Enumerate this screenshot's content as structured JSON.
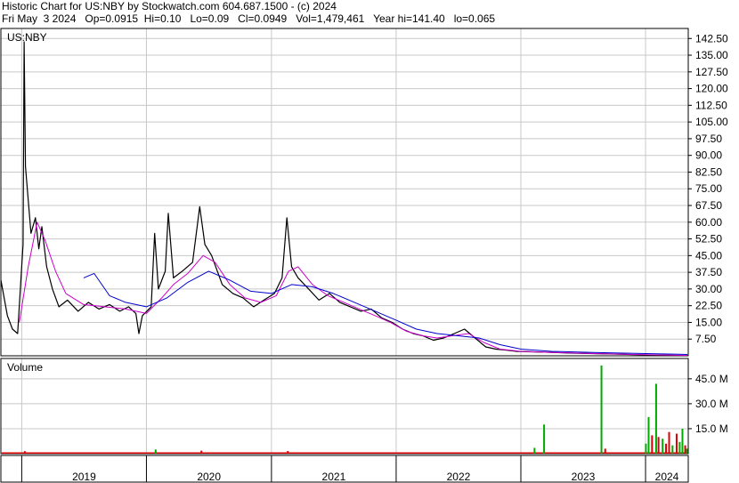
{
  "header": {
    "line1": "Historic Chart for US:NBY by Stockwatch.com 604.687.1500 - (c) 2024",
    "line2": "Fri May  3 2024   Op=0.0915  Hi=0.10   Lo=0.09   Cl=0.0949   Vol=1,479,461   Year hi=141.40   lo=0.065"
  },
  "colors": {
    "price_line": "#000000",
    "ma_short": "#cc00cc",
    "ma_long": "#0000cc",
    "volume_green": "#00aa00",
    "volume_red": "#dd0000",
    "grid": "#c8c8c8"
  },
  "chart_data": [
    {
      "type": "line",
      "title": "US:NBY",
      "ylim": [
        0,
        147
      ],
      "y_ticks": [
        "142.50",
        "135.00",
        "127.50",
        "120.00",
        "112.50",
        "105.00",
        "97.50",
        "90.00",
        "82.50",
        "75.00",
        "67.50",
        "60.00",
        "52.50",
        "45.00",
        "37.50",
        "30.00",
        "22.50",
        "15.00",
        "7.50"
      ],
      "x_labels": [
        "2019",
        "2020",
        "2021",
        "2022",
        "2023",
        "2024"
      ],
      "x_range": [
        "2018-11",
        "2024-05"
      ],
      "series": [
        {
          "style": "price",
          "points": [
            [
              "2018-11-01",
              34
            ],
            [
              "2018-11-20",
              18
            ],
            [
              "2018-12-05",
              12
            ],
            [
              "2018-12-20",
              10
            ],
            [
              "2019-01-05",
              50
            ],
            [
              "2019-01-08",
              141
            ],
            [
              "2019-01-12",
              85
            ],
            [
              "2019-01-20",
              70
            ],
            [
              "2019-01-28",
              55
            ],
            [
              "2019-02-10",
              62
            ],
            [
              "2019-02-20",
              48
            ],
            [
              "2019-03-01",
              58
            ],
            [
              "2019-03-15",
              40
            ],
            [
              "2019-04-01",
              30
            ],
            [
              "2019-04-20",
              22
            ],
            [
              "2019-05-15",
              25
            ],
            [
              "2019-06-15",
              20
            ],
            [
              "2019-07-15",
              24
            ],
            [
              "2019-08-15",
              21
            ],
            [
              "2019-09-15",
              23
            ],
            [
              "2019-10-15",
              20
            ],
            [
              "2019-11-10",
              22
            ],
            [
              "2019-12-01",
              19
            ],
            [
              "2019-12-10",
              10
            ],
            [
              "2019-12-20",
              18
            ],
            [
              "2020-01-15",
              22
            ],
            [
              "2020-01-25",
              55
            ],
            [
              "2020-02-05",
              30
            ],
            [
              "2020-02-25",
              38
            ],
            [
              "2020-03-05",
              64
            ],
            [
              "2020-03-20",
              35
            ],
            [
              "2020-04-15",
              38
            ],
            [
              "2020-05-15",
              42
            ],
            [
              "2020-06-05",
              67
            ],
            [
              "2020-06-20",
              50
            ],
            [
              "2020-07-10",
              45
            ],
            [
              "2020-08-10",
              32
            ],
            [
              "2020-09-10",
              28
            ],
            [
              "2020-10-10",
              26
            ],
            [
              "2020-11-10",
              22
            ],
            [
              "2020-12-10",
              25
            ],
            [
              "2021-01-10",
              28
            ],
            [
              "2021-02-01",
              35
            ],
            [
              "2021-02-15",
              62
            ],
            [
              "2021-03-01",
              40
            ],
            [
              "2021-03-20",
              35
            ],
            [
              "2021-04-20",
              30
            ],
            [
              "2021-05-20",
              25
            ],
            [
              "2021-06-20",
              28
            ],
            [
              "2021-07-20",
              24
            ],
            [
              "2021-08-20",
              22
            ],
            [
              "2021-09-20",
              20
            ],
            [
              "2021-10-20",
              21
            ],
            [
              "2021-11-20",
              17
            ],
            [
              "2021-12-20",
              15
            ],
            [
              "2022-01-20",
              12
            ],
            [
              "2022-02-20",
              10
            ],
            [
              "2022-03-20",
              9
            ],
            [
              "2022-04-20",
              7
            ],
            [
              "2022-05-20",
              8
            ],
            [
              "2022-06-20",
              10
            ],
            [
              "2022-07-20",
              12
            ],
            [
              "2022-08-20",
              8
            ],
            [
              "2022-09-20",
              4
            ],
            [
              "2022-10-20",
              3
            ],
            [
              "2022-11-20",
              2.5
            ],
            [
              "2022-12-20",
              2
            ],
            [
              "2023-02-01",
              1.8
            ],
            [
              "2023-04-01",
              1.5
            ],
            [
              "2023-06-01",
              1.2
            ],
            [
              "2023-08-01",
              1
            ],
            [
              "2023-10-01",
              0.8
            ],
            [
              "2023-12-01",
              0.5
            ],
            [
              "2024-02-01",
              0.3
            ],
            [
              "2024-05-03",
              0.0949
            ]
          ]
        },
        {
          "style": "ma_short",
          "points": [
            [
              "2018-12-25",
              15
            ],
            [
              "2019-01-20",
              40
            ],
            [
              "2019-02-15",
              60
            ],
            [
              "2019-03-10",
              52
            ],
            [
              "2019-04-10",
              38
            ],
            [
              "2019-05-10",
              28
            ],
            [
              "2019-07-01",
              23
            ],
            [
              "2019-09-01",
              22
            ],
            [
              "2019-11-01",
              21
            ],
            [
              "2020-01-01",
              19
            ],
            [
              "2020-02-15",
              26
            ],
            [
              "2020-03-20",
              32
            ],
            [
              "2020-05-01",
              37
            ],
            [
              "2020-06-15",
              45
            ],
            [
              "2020-07-20",
              42
            ],
            [
              "2020-09-01",
              32
            ],
            [
              "2020-10-15",
              26
            ],
            [
              "2020-12-01",
              24
            ],
            [
              "2021-01-15",
              27
            ],
            [
              "2021-02-20",
              38
            ],
            [
              "2021-03-20",
              40
            ],
            [
              "2021-05-01",
              32
            ],
            [
              "2021-06-15",
              27
            ],
            [
              "2021-08-01",
              24
            ],
            [
              "2021-09-15",
              21
            ],
            [
              "2021-11-01",
              18
            ],
            [
              "2021-12-15",
              15
            ],
            [
              "2022-02-01",
              11
            ],
            [
              "2022-03-20",
              9
            ],
            [
              "2022-05-01",
              8
            ],
            [
              "2022-06-15",
              9
            ],
            [
              "2022-08-01",
              10
            ],
            [
              "2022-09-15",
              6
            ],
            [
              "2022-11-01",
              3
            ],
            [
              "2023-01-01",
              2
            ],
            [
              "2023-04-01",
              1.5
            ],
            [
              "2023-08-01",
              1
            ],
            [
              "2024-01-01",
              0.5
            ],
            [
              "2024-05-03",
              0.2
            ]
          ]
        },
        {
          "style": "ma_long",
          "points": [
            [
              "2019-07-01",
              35
            ],
            [
              "2019-08-01",
              37
            ],
            [
              "2019-09-15",
              27
            ],
            [
              "2019-11-01",
              24
            ],
            [
              "2020-01-01",
              22
            ],
            [
              "2020-03-01",
              26
            ],
            [
              "2020-05-01",
              33
            ],
            [
              "2020-07-01",
              38
            ],
            [
              "2020-09-01",
              34
            ],
            [
              "2020-11-01",
              29
            ],
            [
              "2021-01-01",
              28
            ],
            [
              "2021-03-01",
              32
            ],
            [
              "2021-05-01",
              31
            ],
            [
              "2021-07-01",
              28
            ],
            [
              "2021-09-01",
              24
            ],
            [
              "2021-11-01",
              20
            ],
            [
              "2022-01-01",
              16
            ],
            [
              "2022-03-01",
              12
            ],
            [
              "2022-05-01",
              10
            ],
            [
              "2022-07-01",
              9
            ],
            [
              "2022-09-01",
              8
            ],
            [
              "2022-11-01",
              5
            ],
            [
              "2023-01-01",
              3
            ],
            [
              "2023-04-01",
              2
            ],
            [
              "2023-08-01",
              1.5
            ],
            [
              "2024-01-01",
              1
            ],
            [
              "2024-05-03",
              0.6
            ]
          ]
        }
      ]
    },
    {
      "type": "bar",
      "title": "Volume",
      "ylim": [
        0,
        54
      ],
      "y_ticks": [
        "45.0 M",
        "30.0 M",
        "15.0 M"
      ],
      "baseline_volume_m": 0.8,
      "bars": [
        {
          "x": "2019-01-10",
          "v": 1.5,
          "color": "red"
        },
        {
          "x": "2020-01-28",
          "v": 2.5,
          "color": "green"
        },
        {
          "x": "2020-06-10",
          "v": 1.8,
          "color": "red"
        },
        {
          "x": "2021-02-18",
          "v": 1.6,
          "color": "red"
        },
        {
          "x": "2023-02-10",
          "v": 3.5,
          "color": "green"
        },
        {
          "x": "2023-03-10",
          "v": 17.5,
          "color": "green"
        },
        {
          "x": "2023-08-25",
          "v": 53.0,
          "color": "green"
        },
        {
          "x": "2023-09-05",
          "v": 3.0,
          "color": "red"
        },
        {
          "x": "2024-01-02",
          "v": 6.0,
          "color": "green"
        },
        {
          "x": "2024-01-10",
          "v": 22.0,
          "color": "green"
        },
        {
          "x": "2024-01-20",
          "v": 11.0,
          "color": "red"
        },
        {
          "x": "2024-02-01",
          "v": 42.0,
          "color": "green"
        },
        {
          "x": "2024-02-08",
          "v": 10.0,
          "color": "red"
        },
        {
          "x": "2024-02-20",
          "v": 9.0,
          "color": "green"
        },
        {
          "x": "2024-03-01",
          "v": 6.0,
          "color": "red"
        },
        {
          "x": "2024-03-10",
          "v": 13.0,
          "color": "red"
        },
        {
          "x": "2024-03-20",
          "v": 5.0,
          "color": "green"
        },
        {
          "x": "2024-04-01",
          "v": 12.0,
          "color": "red"
        },
        {
          "x": "2024-04-10",
          "v": 7.0,
          "color": "green"
        },
        {
          "x": "2024-04-18",
          "v": 15.0,
          "color": "green"
        },
        {
          "x": "2024-04-26",
          "v": 5.0,
          "color": "red"
        },
        {
          "x": "2024-05-01",
          "v": 3.0,
          "color": "green"
        }
      ]
    }
  ]
}
